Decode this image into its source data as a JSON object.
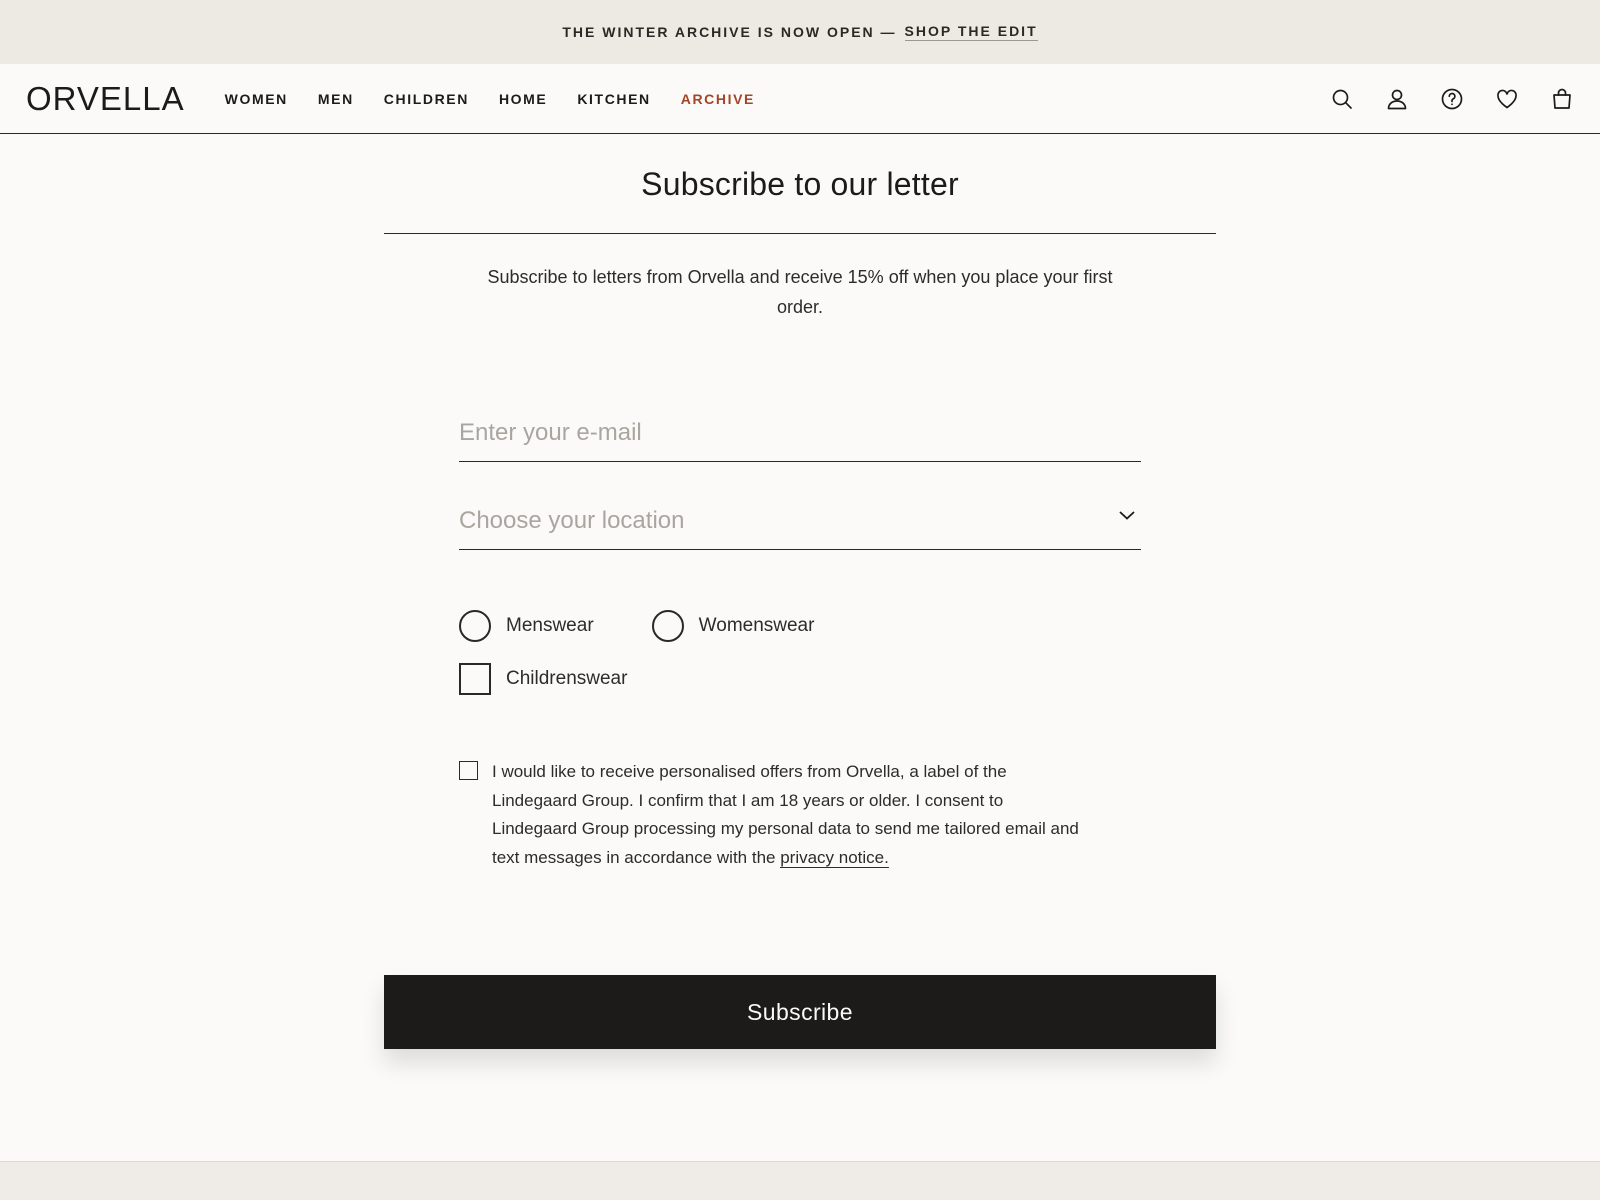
{
  "announcement": {
    "text": "THE WINTER ARCHIVE IS NOW OPEN —",
    "link": "SHOP THE EDIT"
  },
  "header": {
    "logo": "ORVELLA",
    "nav": [
      "WOMEN",
      "MEN",
      "CHILDREN",
      "HOME",
      "KITCHEN",
      "ARCHIVE"
    ],
    "accent_color": "#a64428",
    "icons": [
      "search-icon",
      "account-icon",
      "help-icon",
      "wishlist-icon",
      "bag-icon"
    ]
  },
  "main": {
    "title": "Subscribe to our letter",
    "intro": "Subscribe to letters from Orvella and receive 15% off when you place your first order.",
    "form": {
      "email_placeholder": "Enter your e-mail",
      "location_placeholder": "Choose your location",
      "choices": {
        "menswear": "Menswear",
        "womenswear": "Womenswear",
        "childrenswear": "Childrenswear"
      },
      "consent_text": "I would like to receive personalised offers from Orvella, a label of the Lindegaard Group. I confirm that I am 18 years or older. I consent to Lindegaard Group processing my personal data to send me tailored email and text messages in accordance with the ",
      "consent_link": "privacy notice.",
      "submit_label": "Subscribe"
    }
  }
}
